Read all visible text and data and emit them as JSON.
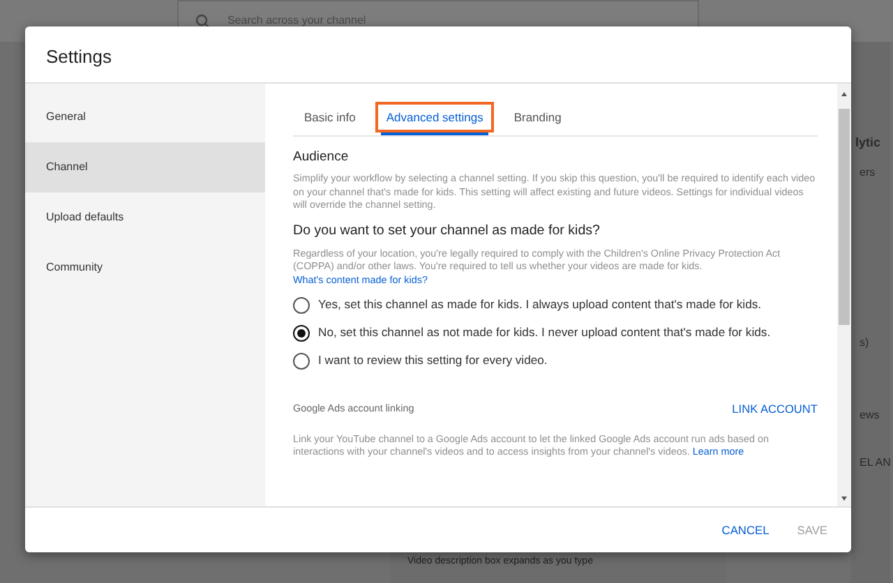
{
  "background": {
    "search": {
      "placeholder": "Search across your channel"
    },
    "side_texts": [
      "lytic",
      "ers",
      "s)",
      "ews",
      "EL AN"
    ],
    "footer_text": "Video description box expands as you type"
  },
  "dialog": {
    "title": "Settings",
    "sidebar": {
      "items": [
        {
          "label": "General",
          "selected": false
        },
        {
          "label": "Channel",
          "selected": true
        },
        {
          "label": "Upload defaults",
          "selected": false
        },
        {
          "label": "Community",
          "selected": false
        }
      ]
    },
    "tabs": [
      {
        "label": "Basic info",
        "selected": false,
        "highlighted": false
      },
      {
        "label": "Advanced settings",
        "selected": true,
        "highlighted": true
      },
      {
        "label": "Branding",
        "selected": false,
        "highlighted": false
      }
    ],
    "audience": {
      "heading": "Audience",
      "description": "Simplify your workflow by selecting a channel setting. If you skip this question, you'll be required to identify each video on your channel that's made for kids. This setting will affect existing and future videos. Settings for individual videos will override the channel setting.",
      "question": "Do you want to set your channel as made for kids?",
      "note": "Regardless of your location, you're legally required to comply with the Children's Online Privacy Protection Act (COPPA) and/or other laws. You're required to tell us whether your videos are made for kids.",
      "note_link": "What's content made for kids?",
      "options": [
        {
          "label": "Yes, set this channel as made for kids. I always upload content that's made for kids.",
          "selected": false
        },
        {
          "label": "No, set this channel as not made for kids. I never upload content that's made for kids.",
          "selected": true
        },
        {
          "label": "I want to review this setting for every video.",
          "selected": false
        }
      ]
    },
    "ads": {
      "heading": "Google Ads account linking",
      "action": "LINK ACCOUNT",
      "description": "Link your YouTube channel to a Google Ads account to let the linked Google Ads account run ads based on interactions with your channel's videos and to access insights from your channel's videos.",
      "link": "Learn more"
    },
    "buttons": [
      {
        "label": "CANCEL",
        "disabled": false
      },
      {
        "label": "SAVE",
        "disabled": true
      }
    ]
  }
}
